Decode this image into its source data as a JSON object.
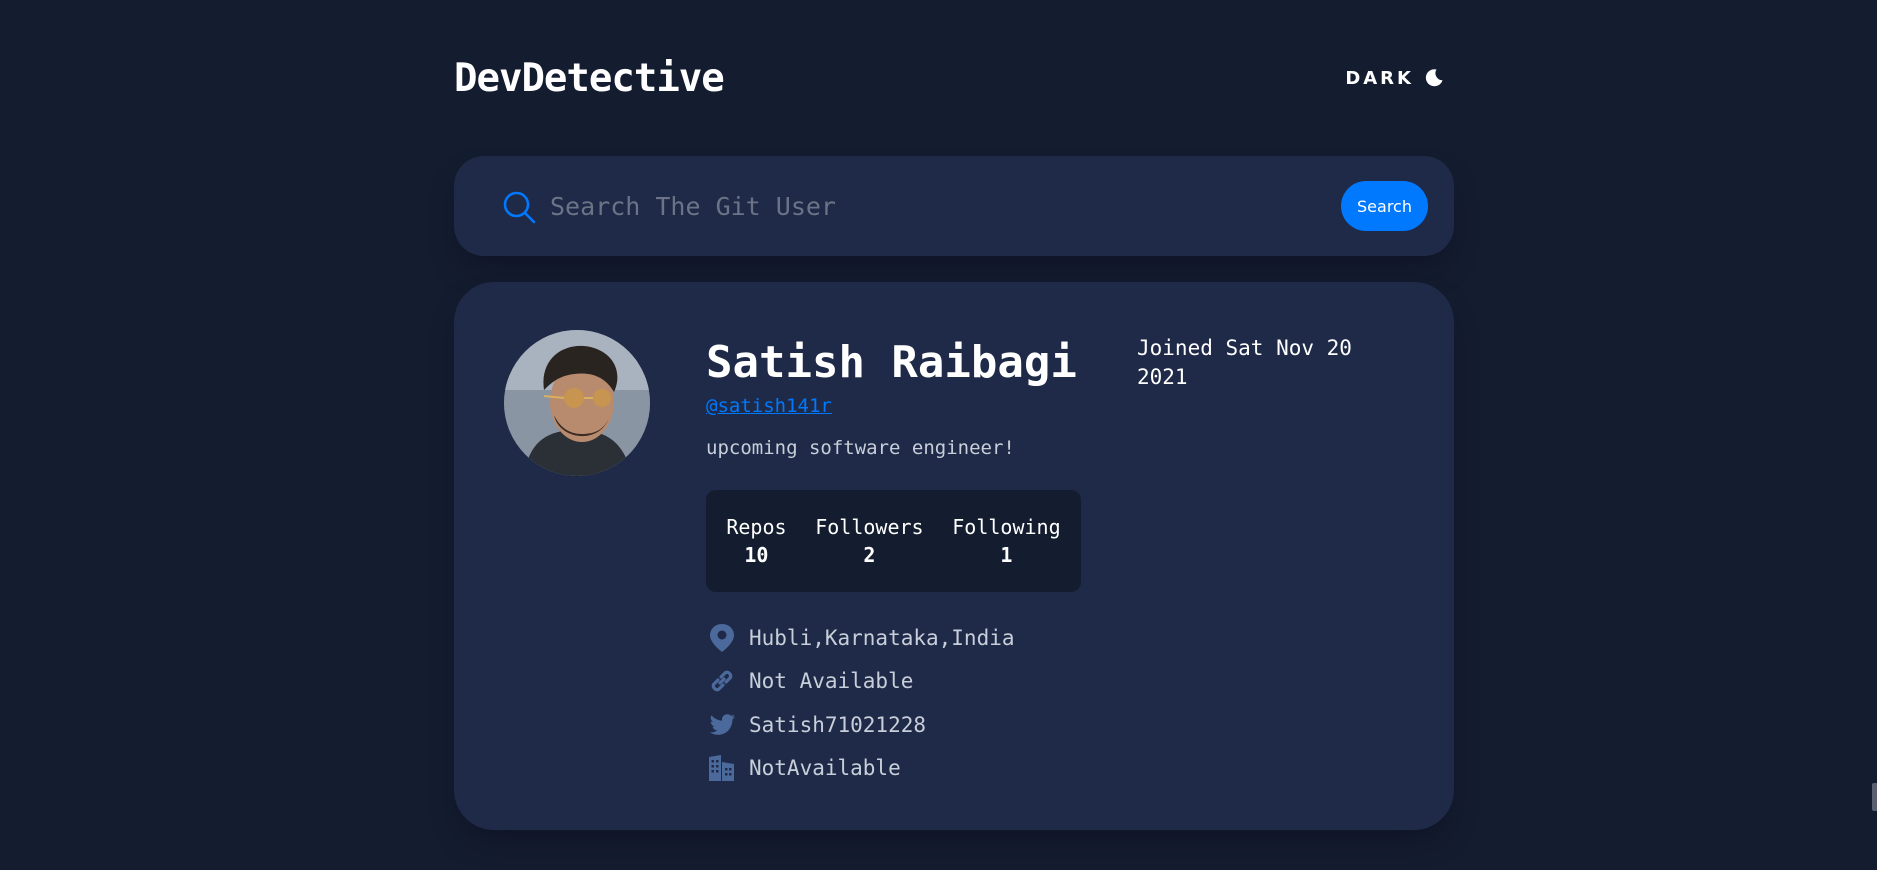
{
  "header": {
    "logo": "DevDetective",
    "mode_label": "DARK",
    "mode_icon": "moon-icon"
  },
  "search": {
    "placeholder": "Search The Git User",
    "value": "",
    "button_label": "Search",
    "icon": "search-icon"
  },
  "profile": {
    "name": "Satish Raibagi",
    "handle": "@satish141r",
    "joined": "Joined Sat Nov 20 2021",
    "bio": "upcoming software engineer!",
    "stats": [
      {
        "label": "Repos",
        "value": "10"
      },
      {
        "label": "Followers",
        "value": "2"
      },
      {
        "label": "Following",
        "value": "1"
      }
    ],
    "links": [
      {
        "icon": "location-icon",
        "text": "Hubli,Karnataka,India"
      },
      {
        "icon": "link-icon",
        "text": "Not Available"
      },
      {
        "icon": "twitter-icon",
        "text": "Satish71021228"
      },
      {
        "icon": "company-icon",
        "text": "NotAvailable"
      }
    ]
  },
  "colors": {
    "background": "#141c2f",
    "card": "#1e2a47",
    "accent": "#0079ff",
    "icon_muted": "#4b6a9b"
  }
}
